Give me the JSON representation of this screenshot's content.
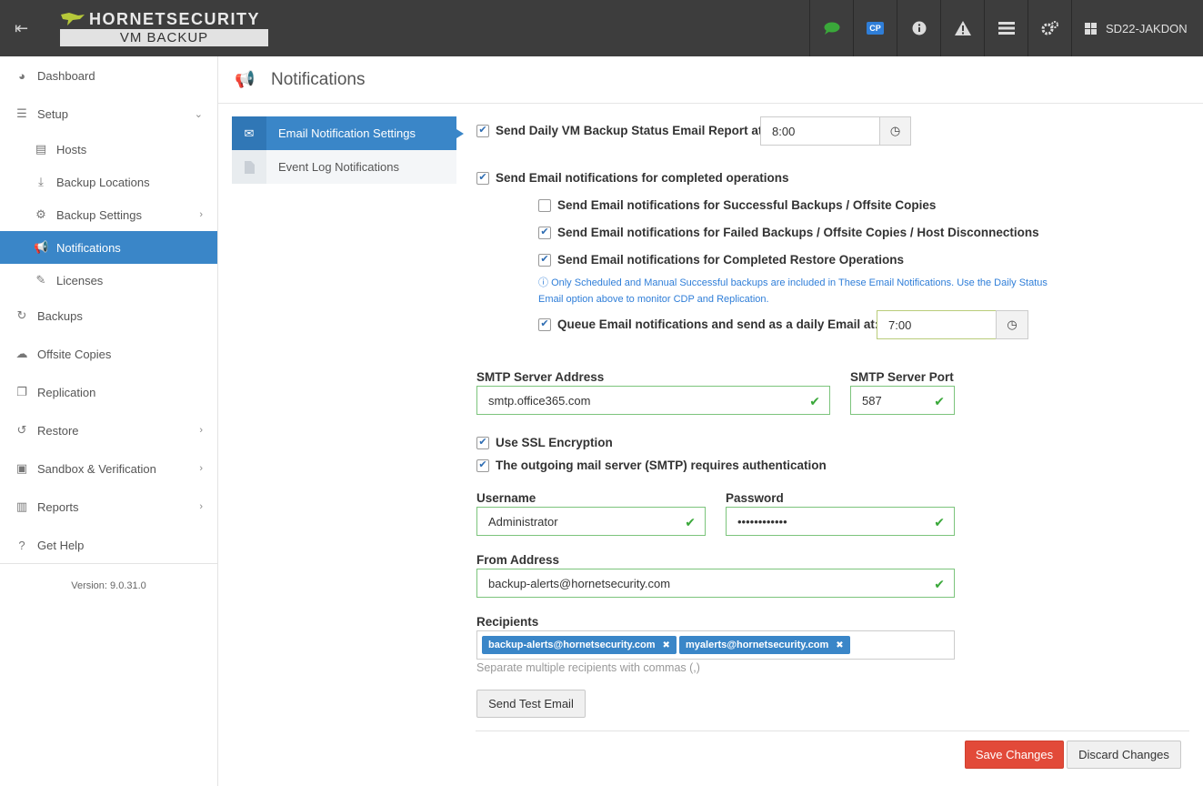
{
  "topbar": {
    "menu_icon": "menu-collapse-icon",
    "logo_top": "HORNETSECURITY",
    "logo_bottom": "VM BACKUP",
    "cp_badge": "CP",
    "server_name": "SD22-JAKDON",
    "icons": [
      "chat-icon",
      "cp-icon",
      "info-icon",
      "warning-icon",
      "list-icon",
      "cogs-icon",
      "windows-icon"
    ]
  },
  "sidebar": {
    "items": [
      {
        "label": "Dashboard",
        "icon": "dashboard-icon"
      },
      {
        "label": "Setup",
        "icon": "sliders-icon"
      },
      {
        "label": "Hosts",
        "icon": "list-icon"
      },
      {
        "label": "Backup Locations",
        "icon": "download-icon"
      },
      {
        "label": "Backup Settings",
        "icon": "cogs-icon"
      },
      {
        "label": "Notifications",
        "icon": "megaphone-icon"
      },
      {
        "label": "Licenses",
        "icon": "edit-icon"
      },
      {
        "label": "Backups",
        "icon": "refresh-icon"
      },
      {
        "label": "Offsite Copies",
        "icon": "cloud-upload-icon"
      },
      {
        "label": "Replication",
        "icon": "copy-icon"
      },
      {
        "label": "Restore",
        "icon": "undo-icon"
      },
      {
        "label": "Sandbox & Verification",
        "icon": "archive-icon"
      },
      {
        "label": "Reports",
        "icon": "bar-chart-icon"
      },
      {
        "label": "Get Help",
        "icon": "question-icon"
      }
    ],
    "version": "Version: 9.0.31.0"
  },
  "header": {
    "title": "Notifications"
  },
  "tabs": [
    {
      "label": "Email Notification Settings",
      "active": true
    },
    {
      "label": "Event Log Notifications",
      "active": false
    }
  ],
  "form": {
    "daily_report_label": "Send Daily VM Backup Status Email Report at",
    "daily_report_checked": true,
    "daily_report_time": "8:00",
    "completed_ops_label": "Send Email notifications for completed operations",
    "completed_ops_checked": true,
    "successful_label": "Send Email notifications for Successful Backups / Offsite Copies",
    "successful_checked": false,
    "failed_label": "Send Email notifications for Failed Backups / Offsite Copies / Host Disconnections",
    "failed_checked": true,
    "restore_label": "Send Email notifications for Completed Restore Operations",
    "restore_checked": true,
    "info_line1": "Only Scheduled and Manual Successful backups are included in These Email Notifications. Use the Daily Status",
    "info_line2": "Email option above to monitor CDP and Replication.",
    "queue_label": "Queue Email notifications and send as a daily Email at:",
    "queue_checked": true,
    "queue_time": "7:00",
    "smtp_address_label": "SMTP Server Address",
    "smtp_address": "smtp.office365.com",
    "smtp_port_label": "SMTP Server Port",
    "smtp_port": "587",
    "ssl_label": "Use SSL Encryption",
    "ssl_checked": true,
    "auth_label": "The outgoing mail server (SMTP) requires authentication",
    "auth_checked": true,
    "username_label": "Username",
    "username": "Administrator",
    "password_label": "Password",
    "password": "••••••••••••",
    "from_label": "From Address",
    "from_address": "backup-alerts@hornetsecurity.com",
    "recipients_label": "Recipients",
    "recipients": [
      "backup-alerts@hornetsecurity.com",
      "myalerts@hornetsecurity.com"
    ],
    "recipients_hint": "Separate multiple recipients with commas (,)",
    "send_test_label": "Send Test Email",
    "save_label": "Save Changes",
    "discard_label": "Discard Changes"
  },
  "colors": {
    "accent": "#3a86c8",
    "danger": "#e24a39",
    "valid": "#3aa83a",
    "topbar": "#3d3d3d"
  }
}
